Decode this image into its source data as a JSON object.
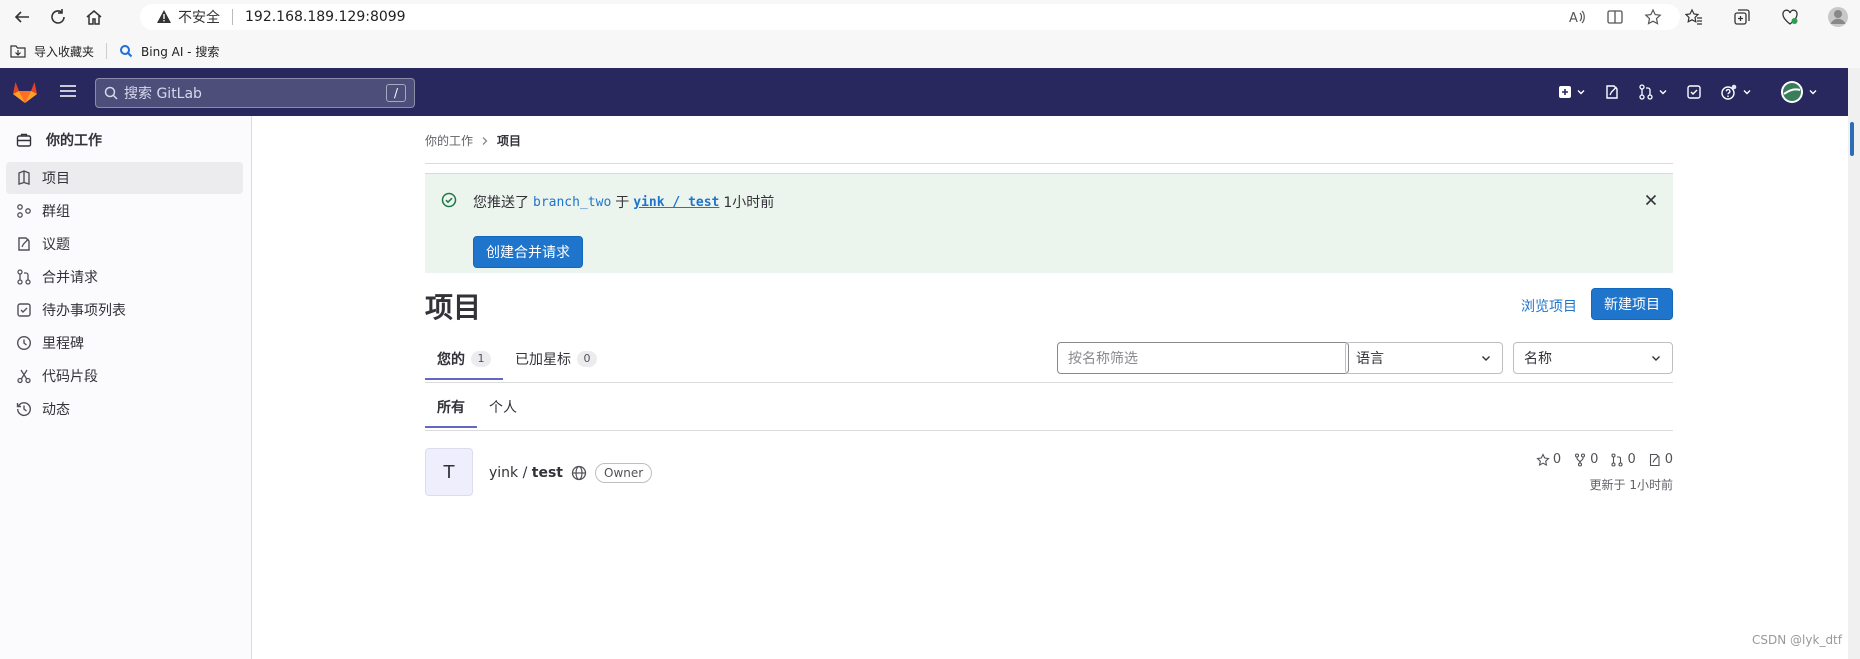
{
  "browser": {
    "insecure_label": "不安全",
    "url": "192.168.189.129:8099",
    "bookmarks": [
      {
        "label": "导入收藏夹"
      },
      {
        "label": "Bing AI - 搜索"
      }
    ]
  },
  "header": {
    "search_placeholder": "搜索 GitLab",
    "search_shortcut": "/"
  },
  "sidebar": {
    "title": "你的工作",
    "items": [
      {
        "label": "项目",
        "icon": "project-icon",
        "active": true
      },
      {
        "label": "群组",
        "icon": "group-icon"
      },
      {
        "label": "议题",
        "icon": "issues-icon"
      },
      {
        "label": "合并请求",
        "icon": "merge-request-icon"
      },
      {
        "label": "待办事项列表",
        "icon": "todo-icon"
      },
      {
        "label": "里程碑",
        "icon": "milestone-icon"
      },
      {
        "label": "代码片段",
        "icon": "snippet-icon"
      },
      {
        "label": "动态",
        "icon": "activity-icon"
      }
    ]
  },
  "breadcrumb": {
    "parent": "你的工作",
    "current": "项目"
  },
  "alert": {
    "prefix": "您推送了",
    "branch": "branch_two",
    "middle": "于",
    "project": "yink / test",
    "time": "1小时前",
    "button": "创建合并请求"
  },
  "page": {
    "title": "项目",
    "browse_link": "浏览项目",
    "new_button": "新建项目"
  },
  "tabs": {
    "primary": [
      {
        "label": "您的",
        "count": "1"
      },
      {
        "label": "已加星标",
        "count": "0"
      }
    ],
    "secondary": [
      {
        "label": "所有"
      },
      {
        "label": "个人"
      }
    ]
  },
  "filters": {
    "name_placeholder": "按名称筛选",
    "language": "语言",
    "sort": "名称"
  },
  "project": {
    "avatar_letter": "T",
    "namespace": "yink / ",
    "name": "test",
    "role": "Owner",
    "stars": "0",
    "forks": "0",
    "merge_requests": "0",
    "issues": "0",
    "updated": "更新于 1小时前"
  },
  "watermark": "CSDN @lyk_dtf",
  "colors": {
    "header_bg": "#28285f",
    "primary": "#1f75cb",
    "alert_bg": "#ecf4ee",
    "tab_active": "#6666c4"
  }
}
